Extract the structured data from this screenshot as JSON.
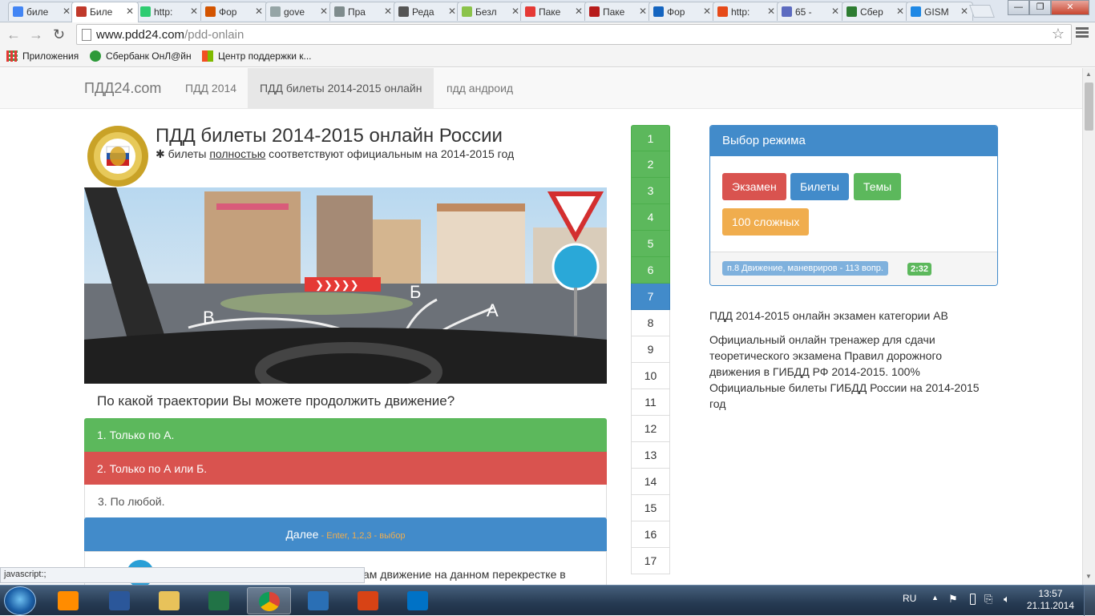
{
  "browser": {
    "tabs": [
      {
        "label": "биле",
        "color": "#4285f4"
      },
      {
        "label": "Биле",
        "color": "#c0392b"
      },
      {
        "label": "http:",
        "color": "#2ecc71"
      },
      {
        "label": "Фор",
        "color": "#d35400"
      },
      {
        "label": "gove",
        "color": "#95a5a6"
      },
      {
        "label": "Пра",
        "color": "#7f8c8d"
      },
      {
        "label": "Реда",
        "color": "#555555"
      },
      {
        "label": "Безл",
        "color": "#8bc34a"
      },
      {
        "label": "Паке",
        "color": "#e53935"
      },
      {
        "label": "Паке",
        "color": "#b71c1c"
      },
      {
        "label": "Фор",
        "color": "#1565c0"
      },
      {
        "label": "http:",
        "color": "#e64a19"
      },
      {
        "label": "65 - ",
        "color": "#5c6bc0"
      },
      {
        "label": "Сбер",
        "color": "#2e7d32"
      },
      {
        "label": "GISM",
        "color": "#1e88e5"
      }
    ],
    "url_domain": "www.pdd24.com",
    "url_path": "/pdd-onlain",
    "bookmarks": [
      "Приложения",
      "Сбербанк ОнЛ@йн",
      "Центр поддержки к..."
    ],
    "status_text": "javascript:;"
  },
  "site": {
    "brand": "ПДД24.com",
    "nav": [
      "ПДД 2014",
      "ПДД билеты 2014-2015 онлайн",
      "пдд андроид"
    ],
    "title": "ПДД билеты 2014-2015 онлайн России",
    "subtitle_icon": "✱",
    "subtitle_a": " билеты ",
    "subtitle_u": "полностью",
    "subtitle_b": " соответствуют официальным на 2014-2015 год",
    "image_labels": {
      "a": "А",
      "b": "Б",
      "v": "В"
    },
    "question": "По какой траектории Вы можете продолжить движение?",
    "answers": [
      "1. Только по А.",
      "2. Только по А или Б.",
      "3. По любой."
    ],
    "next_label": "Далее",
    "next_hint": " - Enter, 1,2,3 - выбор",
    "hint_text": "ам движение на данном перекрестке в",
    "question_numbers": [
      "1",
      "2",
      "3",
      "4",
      "5",
      "6",
      "7",
      "8",
      "9",
      "10",
      "11",
      "12",
      "13",
      "14",
      "15",
      "16",
      "17"
    ],
    "answered_count": 6,
    "current_number": "7",
    "mode_panel": {
      "title": "Выбор режима",
      "buttons": [
        {
          "label": "Экзамен",
          "color": "#d9534f"
        },
        {
          "label": "Билеты",
          "color": "#428bca"
        },
        {
          "label": "Темы",
          "color": "#5cb85c"
        },
        {
          "label": "100 сложных",
          "color": "#f0ad4e"
        }
      ],
      "topic": "п.8 Движение, маневриров - 113 вопр.",
      "time": "2:32"
    },
    "desc_title": "ПДД 2014-2015 онлайн экзамен категории АВ",
    "desc_text": "Официальный онлайн тренажер для сдачи теоретического экзамена Правил дорожного движения в ГИБДД РФ 2014-2015. 100% Официальные билеты ГИБДД России на 2014-2015 год"
  },
  "taskbar": {
    "apps": [
      {
        "name": "media-player",
        "color": "#ff8c00"
      },
      {
        "name": "word",
        "color": "#2b579a"
      },
      {
        "name": "explorer",
        "color": "#e8c25a"
      },
      {
        "name": "excel",
        "color": "#217346"
      },
      {
        "name": "chrome",
        "color": "#4caf50"
      },
      {
        "name": "remote",
        "color": "#2a6fb5"
      },
      {
        "name": "app",
        "color": "#d84315"
      },
      {
        "name": "outlook",
        "color": "#0072c6"
      }
    ],
    "lang": "RU",
    "time": "13:57",
    "date": "21.11.2014"
  }
}
